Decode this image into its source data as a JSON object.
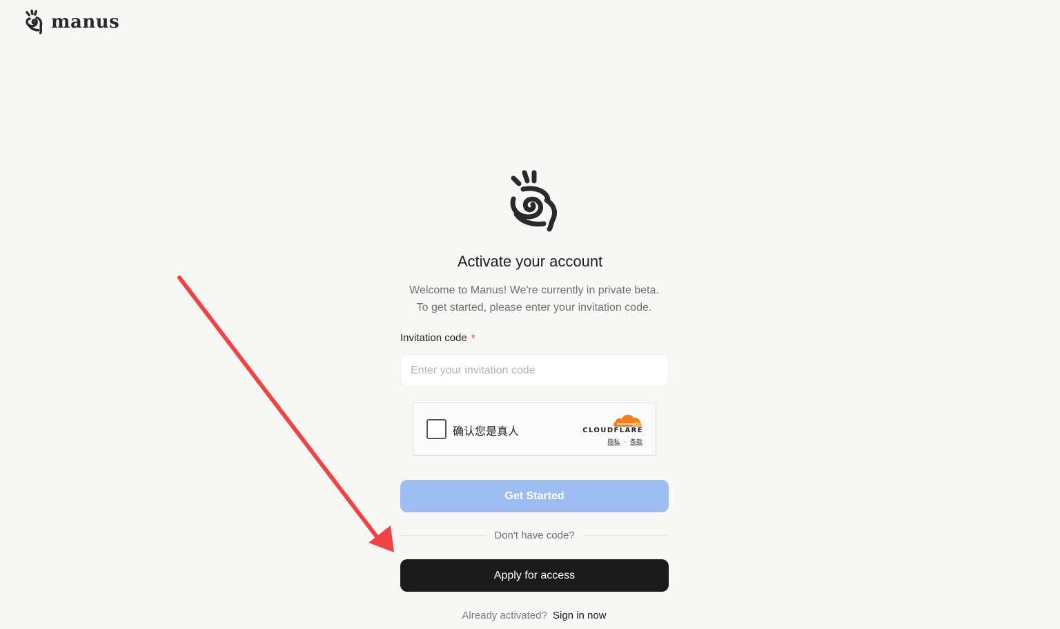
{
  "brand": {
    "name": "manus",
    "icon": "manus-hand-icon"
  },
  "hero": {
    "icon": "manus-hand-icon"
  },
  "form": {
    "title": "Activate your account",
    "subtitle_line1": "Welcome to Manus! We're currently in private beta.",
    "subtitle_line2": "To get started, please enter your invitation code.",
    "invitation_label": "Invitation code",
    "required_mark": "*",
    "invitation_placeholder": "Enter your invitation code",
    "invitation_value": "",
    "get_started_label": "Get Started",
    "divider_text": "Don't have code?",
    "apply_label": "Apply for access",
    "already_activated": "Already activated?",
    "sign_in_label": "Sign in now"
  },
  "captcha": {
    "label": "确认您是真人",
    "provider": "CLOUDFLARE",
    "privacy_link": "隐私",
    "separator": "·",
    "terms_link": "条款",
    "checked": false
  },
  "annotation": {
    "arrow_color": "#f04444"
  },
  "colors": {
    "background": "#f7f7f6",
    "primary_disabled": "#9dbdf2",
    "dark_button": "#1a1a1a",
    "required": "#e5484d",
    "cloudflare_orange": "#f38020"
  }
}
